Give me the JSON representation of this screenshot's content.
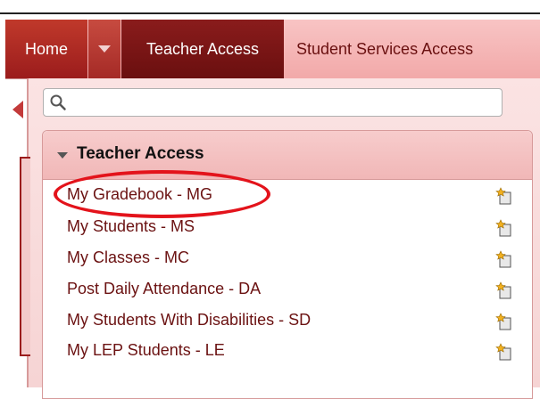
{
  "navbar": {
    "home_label": "Home",
    "teacher_access_label": "Teacher Access",
    "student_services_label": "Student Services Access"
  },
  "search": {
    "value": "",
    "placeholder": ""
  },
  "section": {
    "title": "Teacher Access",
    "items": [
      {
        "label": "My Gradebook - MG"
      },
      {
        "label": "My Students - MS"
      },
      {
        "label": "My Classes - MC"
      },
      {
        "label": "Post Daily Attendance - DA"
      },
      {
        "label": "My Students With Disabilities - SD"
      },
      {
        "label": "My LEP Students - LE"
      }
    ]
  },
  "colors": {
    "nav_active": "#7a1616",
    "nav_home": "#b02a24",
    "link": "#6b1212",
    "highlight": "#e3131b"
  }
}
